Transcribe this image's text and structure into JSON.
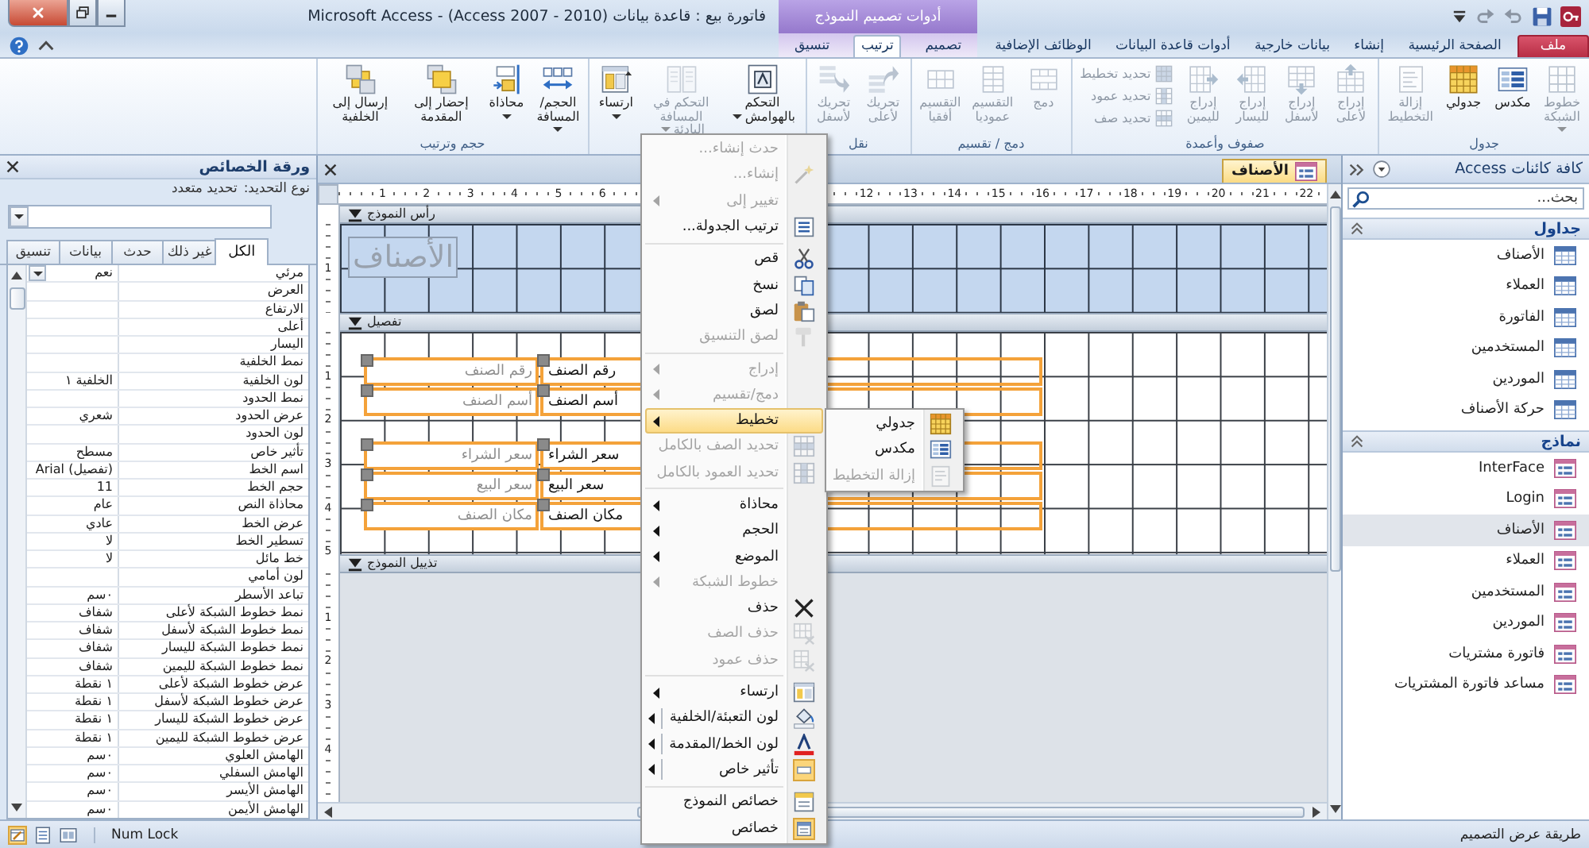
{
  "window": {
    "title": "Microsoft Access - (Access 2007 - 2010) فاتورة بيع : قاعدة بيانات",
    "context_group": "أدوات تصميم النموذج"
  },
  "ribbon": {
    "tabs": [
      {
        "label": "ملف",
        "kind": "file",
        "selected": false
      },
      {
        "label": "الصفحة الرئيسية",
        "kind": "main",
        "selected": false
      },
      {
        "label": "إنشاء",
        "kind": "main",
        "selected": false
      },
      {
        "label": "بيانات خارجية",
        "kind": "main",
        "selected": false
      },
      {
        "label": "أدوات قاعدة البيانات",
        "kind": "main",
        "selected": false
      },
      {
        "label": "الوظائف الإضافية",
        "kind": "main",
        "selected": false
      },
      {
        "label": "تصميم",
        "kind": "context",
        "selected": false
      },
      {
        "label": "ترتيب",
        "kind": "context",
        "selected": true
      },
      {
        "label": "تنسيق",
        "kind": "context",
        "selected": false
      }
    ],
    "groups": [
      {
        "label": "جدول",
        "buttons": [
          {
            "label": "خطوط الشبكة",
            "kind": "large",
            "disabled": true,
            "dropdown": true
          },
          {
            "label": "مكدس",
            "kind": "large",
            "disabled": false,
            "dropdown": false
          },
          {
            "label": "جدولي",
            "kind": "large",
            "disabled": false,
            "dropdown": false
          },
          {
            "label": "إزالة التخطيط",
            "kind": "large",
            "disabled": true,
            "dropdown": false
          }
        ]
      },
      {
        "label": "صفوف وأعمدة",
        "buttons": [
          {
            "label": "إدراج لأعلى",
            "kind": "large",
            "disabled": true,
            "dropdown": false
          },
          {
            "label": "إدراج لأسفل",
            "kind": "large",
            "disabled": true,
            "dropdown": false
          },
          {
            "label": "إدراج لليسار",
            "kind": "large",
            "disabled": true,
            "dropdown": false
          },
          {
            "label": "إدراج لليمين",
            "kind": "large",
            "disabled": true,
            "dropdown": false
          },
          {
            "label": "تحديد تخطيط",
            "kind": "small",
            "disabled": true,
            "dropdown": false
          },
          {
            "label": "تحديد عمود",
            "kind": "small",
            "disabled": true,
            "dropdown": false
          },
          {
            "label": "تحديد صف",
            "kind": "small",
            "disabled": true,
            "dropdown": false
          }
        ]
      },
      {
        "label": "دمج / تقسيم",
        "buttons": [
          {
            "label": "دمج",
            "kind": "large",
            "disabled": true,
            "dropdown": false
          },
          {
            "label": "التقسيم عموديا",
            "kind": "large",
            "disabled": true,
            "dropdown": false
          },
          {
            "label": "التقسيم أفقيا",
            "kind": "large",
            "disabled": true,
            "dropdown": false
          }
        ]
      },
      {
        "label": "نقل",
        "buttons": [
          {
            "label": "تحريك لأعلى",
            "kind": "large",
            "disabled": true,
            "dropdown": false
          },
          {
            "label": "تحريك لأسفل",
            "kind": "large",
            "disabled": true,
            "dropdown": false
          }
        ]
      },
      {
        "buttons": [
          {
            "label": "التحكم بالهوامش",
            "kind": "large",
            "disabled": false,
            "dropdown": true
          },
          {
            "label": "التحكم في المسافة البادئة",
            "kind": "large",
            "disabled": true,
            "dropdown": true
          },
          {
            "label": "ارتساء",
            "kind": "large",
            "disabled": false,
            "dropdown": true
          }
        ]
      },
      {
        "label": "حجم وترتيب",
        "buttons": [
          {
            "label": "الحجم/المسافة",
            "kind": "large",
            "disabled": false,
            "dropdown": true
          },
          {
            "label": "محاذاة",
            "kind": "large",
            "disabled": false,
            "dropdown": true
          },
          {
            "label": "إحضار إلى المقدمة",
            "kind": "large",
            "disabled": false,
            "dropdown": false
          },
          {
            "label": "إرسال إلى الخلفية",
            "kind": "large",
            "disabled": false,
            "dropdown": false
          }
        ]
      }
    ]
  },
  "property_sheet": {
    "title": "ورقة الخصائص",
    "selection_label": "نوع التحديد:",
    "selection_value": "تحديد متعدد",
    "tabs": [
      {
        "label": "الكل",
        "selected": true
      },
      {
        "label": "غير ذلك",
        "selected": false
      },
      {
        "label": "حدث",
        "selected": false
      },
      {
        "label": "بيانات",
        "selected": false
      },
      {
        "label": "تنسيق",
        "selected": false
      }
    ],
    "rows": [
      {
        "name": "مرئي",
        "value": "نعم",
        "selected": true
      },
      {
        "name": "العرض",
        "selected": false
      },
      {
        "name": "الارتفاع",
        "selected": false
      },
      {
        "name": "أعلى",
        "selected": false
      },
      {
        "name": "اليسار",
        "selected": false
      },
      {
        "name": "نمط الخلفية",
        "selected": false
      },
      {
        "name": "لون الخلفية",
        "value": "الخلفية ١",
        "selected": false
      },
      {
        "name": "نمط الحدود",
        "selected": false
      },
      {
        "name": "عرض الحدود",
        "value": "شعري",
        "selected": false
      },
      {
        "name": "لون الحدود",
        "selected": false
      },
      {
        "name": "تأثير خاص",
        "value": "مسطح",
        "selected": false
      },
      {
        "name": "اسم الخط",
        "value": "(تفصيل) Arial",
        "selected": false
      },
      {
        "name": "حجم الخط",
        "value": "11",
        "selected": false
      },
      {
        "name": "محاذاة النص",
        "value": "عام",
        "selected": false
      },
      {
        "name": "عرض الخط",
        "value": "عادي",
        "selected": false
      },
      {
        "name": "تسطير الخط",
        "value": "لا",
        "selected": false
      },
      {
        "name": "خط مائل",
        "value": "لا",
        "selected": false
      },
      {
        "name": "لون أمامي",
        "selected": false
      },
      {
        "name": "تباعد الأسطر",
        "value": "٠سم",
        "selected": false
      },
      {
        "name": "نمط خطوط الشبكة لأعلى",
        "value": "شفاف",
        "selected": false
      },
      {
        "name": "نمط خطوط الشبكة لأسفل",
        "value": "شفاف",
        "selected": false
      },
      {
        "name": "نمط خطوط الشبكة لليسار",
        "value": "شفاف",
        "selected": false
      },
      {
        "name": "نمط خطوط الشبكة لليمين",
        "value": "شفاف",
        "selected": false
      },
      {
        "name": "عرض خطوط الشبكة لأعلى",
        "value": "١ نقطة",
        "selected": false
      },
      {
        "name": "عرض خطوط الشبكة لأسفل",
        "value": "١ نقطة",
        "selected": false
      },
      {
        "name": "عرض خطوط الشبكة لليسار",
        "value": "١ نقطة",
        "selected": false
      },
      {
        "name": "عرض خطوط الشبكة لليمين",
        "value": "١ نقطة",
        "selected": false
      },
      {
        "name": "الهامش العلوي",
        "value": "٠سم",
        "selected": false
      },
      {
        "name": "الهامش السفلي",
        "value": "٠سم",
        "selected": false
      },
      {
        "name": "الهامش الأيسر",
        "value": "٠سم",
        "selected": false
      },
      {
        "name": "الهامش الأيمن",
        "value": "٠سم",
        "selected": false
      }
    ]
  },
  "document": {
    "tab": {
      "label": "الأصناف"
    },
    "h_ruler": [
      [
        "22",
        "21",
        "20",
        "19",
        "18",
        "17",
        "16",
        "15",
        "14",
        "13",
        "12"
      ],
      [
        "6",
        "5",
        "4",
        "3",
        "2",
        "1"
      ]
    ],
    "sections": [
      {
        "label": "رأس النموذج",
        "kind": "header",
        "ruler": [
          "1"
        ],
        "title_label": "الأصناف"
      },
      {
        "label": "تفصيل",
        "kind": "detail",
        "ruler": [
          "1",
          "2",
          "3",
          "4",
          "5"
        ],
        "rows": [
          {
            "kind": "control",
            "field": "رقم الصنف",
            "label": "رقم الصنف"
          },
          {
            "kind": "control",
            "field": "أسم الصنف",
            "label": "أسم الصنف"
          },
          {
            "kind": "empty"
          },
          {
            "kind": "control",
            "field": "سعر الشراء",
            "label": "سعر الشراء"
          },
          {
            "kind": "control",
            "field": "سعر البيع",
            "label": "سعر البيع"
          },
          {
            "kind": "control",
            "field": "مكان الصنف",
            "label": "مكان الصنف"
          }
        ]
      },
      {
        "label": "تذييل النموذج",
        "kind": "footer",
        "ruler": [
          "1",
          "2",
          "3",
          "4"
        ]
      }
    ]
  },
  "context_menu": {
    "sections": [
      {
        "items": [
          {
            "label": "حدث إنشاء...",
            "disabled": true,
            "submenu": false,
            "split": false,
            "checked": false,
            "selected": false
          },
          {
            "label": "إنشاء...",
            "disabled": true,
            "submenu": false,
            "split": false,
            "checked": false,
            "selected": false
          },
          {
            "label": "تغيير إلى",
            "disabled": true,
            "submenu": true,
            "split": false,
            "checked": false,
            "selected": false
          },
          {
            "label": "ترتيب الجدولة...",
            "disabled": false,
            "submenu": false,
            "split": false,
            "checked": false,
            "selected": false
          }
        ]
      },
      {
        "items": [
          {
            "label": "قص",
            "disabled": false,
            "submenu": false,
            "split": false,
            "checked": false,
            "selected": false
          },
          {
            "label": "نسخ",
            "disabled": false,
            "submenu": false,
            "split": false,
            "checked": false,
            "selected": false
          },
          {
            "label": "لصق",
            "disabled": false,
            "submenu": false,
            "split": false,
            "checked": false,
            "selected": false
          },
          {
            "label": "لصق التنسيق",
            "disabled": true,
            "submenu": false,
            "split": false,
            "checked": false,
            "selected": false
          }
        ]
      },
      {
        "items": [
          {
            "label": "إدراج",
            "disabled": true,
            "submenu": true,
            "split": false,
            "checked": false,
            "selected": false
          },
          {
            "label": "دمج/تقسيم",
            "disabled": true,
            "submenu": true,
            "split": false,
            "checked": false,
            "selected": false
          },
          {
            "label": "تخطيط",
            "disabled": false,
            "submenu": true,
            "split": false,
            "checked": false,
            "selected": true
          },
          {
            "label": "تحديد الصف بالكامل",
            "disabled": true,
            "submenu": false,
            "split": false,
            "checked": false,
            "selected": false
          },
          {
            "label": "تحديد العمود بالكامل",
            "disabled": true,
            "submenu": false,
            "split": false,
            "checked": false,
            "selected": false
          }
        ]
      },
      {
        "items": [
          {
            "label": "محاذاة",
            "disabled": false,
            "submenu": true,
            "split": false,
            "checked": false,
            "selected": false
          },
          {
            "label": "الحجم",
            "disabled": false,
            "submenu": true,
            "split": false,
            "checked": false,
            "selected": false
          },
          {
            "label": "الموضع",
            "disabled": false,
            "submenu": true,
            "split": false,
            "checked": false,
            "selected": false
          },
          {
            "label": "خطوط الشبكة",
            "disabled": true,
            "submenu": true,
            "split": false,
            "checked": false,
            "selected": false
          },
          {
            "label": "حذف",
            "disabled": false,
            "submenu": false,
            "split": false,
            "checked": false,
            "selected": false
          },
          {
            "label": "حذف الصف",
            "disabled": true,
            "submenu": false,
            "split": false,
            "checked": false,
            "selected": false
          },
          {
            "label": "حذف عمود",
            "disabled": true,
            "submenu": false,
            "split": false,
            "checked": false,
            "selected": false
          }
        ]
      },
      {
        "items": [
          {
            "label": "ارتساء",
            "disabled": false,
            "submenu": true,
            "split": false,
            "checked": false,
            "selected": false
          },
          {
            "label": "لون التعبئة/الخلفية",
            "disabled": false,
            "submenu": true,
            "split": true,
            "checked": false,
            "selected": false
          },
          {
            "label": "لون الخط/المقدمة",
            "disabled": false,
            "submenu": true,
            "split": true,
            "checked": false,
            "selected": false
          },
          {
            "label": "تأثير خاص",
            "disabled": false,
            "submenu": true,
            "split": true,
            "checked": true,
            "selected": false
          }
        ]
      },
      {
        "items": [
          {
            "label": "خصائص النموذج",
            "disabled": false,
            "submenu": false,
            "split": false,
            "checked": false,
            "selected": false
          },
          {
            "label": "خصائص",
            "disabled": false,
            "submenu": false,
            "split": false,
            "checked": true,
            "selected": false
          }
        ]
      }
    ]
  },
  "submenu": {
    "items": [
      {
        "label": "جدولي",
        "disabled": false,
        "selected": false
      },
      {
        "label": "مكدس",
        "disabled": false,
        "selected": false
      },
      {
        "label": "إزالة التخطيط",
        "disabled": true,
        "selected": false
      }
    ]
  },
  "nav_pane": {
    "title": "كافة كائنات Access",
    "search": {
      "placeholder": "بحث..."
    },
    "groups": [
      {
        "label": "جداول",
        "kind": "table",
        "expanded": true,
        "items": [
          {
            "label": "الأصناف",
            "selected": false
          },
          {
            "label": "العملاء",
            "selected": false
          },
          {
            "label": "الفاتورة",
            "selected": false
          },
          {
            "label": "المستخدمين",
            "selected": false
          },
          {
            "label": "الموردين",
            "selected": false
          },
          {
            "label": "حركة الأصناف",
            "selected": false
          }
        ]
      },
      {
        "label": "نماذج",
        "kind": "form",
        "expanded": true,
        "items": [
          {
            "label": "InterFace",
            "selected": false
          },
          {
            "label": "Login",
            "selected": false
          },
          {
            "label": "الأصناف",
            "selected": true
          },
          {
            "label": "العملاء",
            "selected": false
          },
          {
            "label": "المستخدمين",
            "selected": false
          },
          {
            "label": "الموردين",
            "selected": false
          },
          {
            "label": "فاتورة مشتريات",
            "selected": false
          },
          {
            "label": "مساعد فاتورة المشتريات",
            "selected": false
          }
        ]
      }
    ]
  },
  "status_bar": {
    "mode": "طريقة عرض التصميم",
    "indicator": "Num Lock",
    "views": [
      {
        "selected": false
      },
      {
        "selected": false
      },
      {
        "selected": true
      }
    ]
  }
}
